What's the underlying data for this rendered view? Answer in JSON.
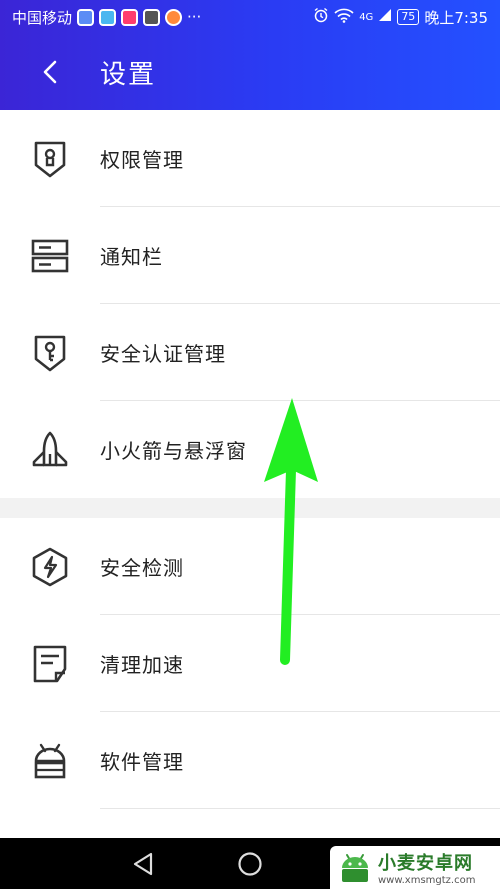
{
  "status_bar": {
    "carrier": "中国移动",
    "more": "···",
    "network": "4G",
    "battery": "75",
    "time": "晚上7:35"
  },
  "header": {
    "title": "设置"
  },
  "group1": [
    {
      "label": "权限管理",
      "icon": "shield-lock-icon"
    },
    {
      "label": "通知栏",
      "icon": "notification-bar-icon"
    },
    {
      "label": "安全认证管理",
      "icon": "shield-key-icon"
    },
    {
      "label": "小火箭与悬浮窗",
      "icon": "rocket-icon"
    }
  ],
  "group2": [
    {
      "label": "安全检测",
      "icon": "security-scan-icon"
    },
    {
      "label": "清理加速",
      "icon": "cleanup-icon"
    },
    {
      "label": "软件管理",
      "icon": "android-icon"
    }
  ],
  "watermark": {
    "main": "小麦安卓网",
    "sub": "www.xmsmgtz.com"
  },
  "colors": {
    "header_start": "#3b25d6",
    "header_end": "#2451ff",
    "arrow": "#22ee22"
  }
}
